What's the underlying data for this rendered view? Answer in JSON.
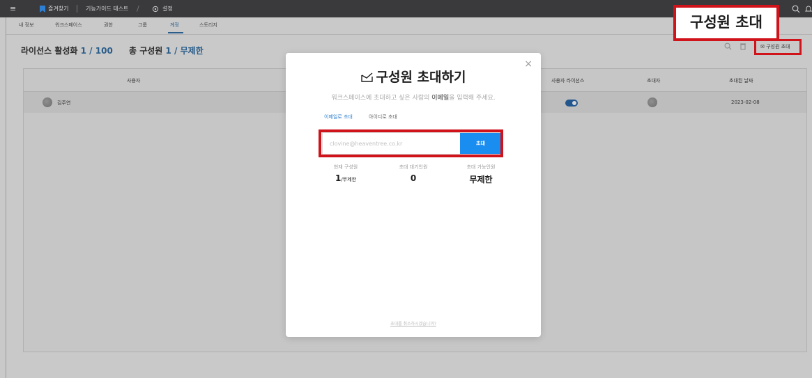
{
  "topbar": {
    "bookmarks_label": "즐겨찾기",
    "workspace_label": "기능가이드 테스트",
    "settings_label": "설정"
  },
  "tabs": [
    "내 정보",
    "워크스페이스",
    "권한",
    "그룹",
    "계정",
    "스토리지"
  ],
  "stats": {
    "license_label": "라이선스 활성화",
    "license_value": "1 / 100",
    "members_label": "총 구성원",
    "members_value": "1 / 무제한"
  },
  "table": {
    "headers": [
      "사용자",
      "사용자 라이선스",
      "초대자",
      "초대된 날짜"
    ],
    "row": {
      "user": "김주연",
      "date": "2023-02-08"
    }
  },
  "invite_button_label": "구성원 초대",
  "callout_label": "구성원 초대",
  "modal": {
    "close": "×",
    "title": "구성원 초대하기",
    "subtitle_pre": "워크스페이스에 초대하고 싶은 사람의 ",
    "subtitle_bold": "이메일",
    "subtitle_post": "을 입력해 주세요.",
    "tab_email": "이메일로 초대",
    "tab_id": "아이디로 초대",
    "email_placeholder": "clovine@heaventree.co.kr",
    "send_label": "초대",
    "current_label": "현재 구성원",
    "current_value": "1",
    "current_suffix": "/무제한",
    "pending_label": "초대 대기인원",
    "pending_value": "0",
    "available_label": "초대 가능인원",
    "available_value": "무제한",
    "cancel_link": "초대를 취소하시겠습니까?"
  },
  "colors": {
    "accent": "#1a8df0",
    "highlight": "#d0121b"
  }
}
